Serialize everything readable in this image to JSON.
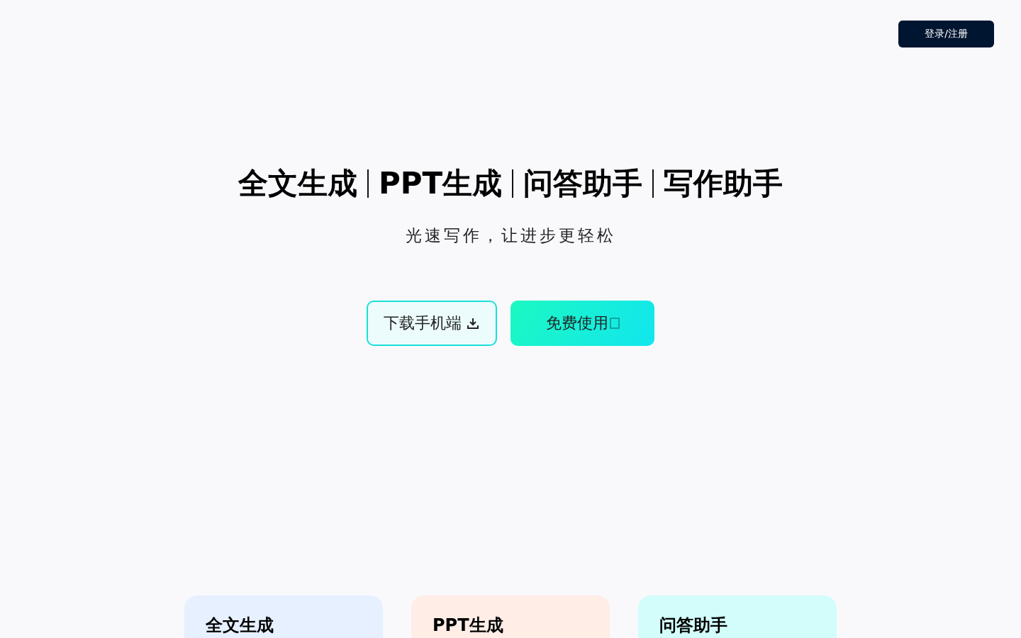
{
  "header": {
    "login_button": "登录/注册"
  },
  "hero": {
    "features": [
      "全文生成",
      "PPT生成",
      "问答助手",
      "写作助手"
    ],
    "tagline": "光速写作，让进步更轻松",
    "buttons": [
      {
        "label": "下载手机端",
        "kind": "download"
      },
      {
        "label": "免费使用",
        "kind": "primary"
      }
    ]
  },
  "cards": [
    {
      "title": "全文生成",
      "color": "#e6f0ff"
    },
    {
      "title": "PPT生成",
      "color": "#ffede6"
    },
    {
      "title": "问答助手",
      "color": "#d2fdfa"
    }
  ]
}
